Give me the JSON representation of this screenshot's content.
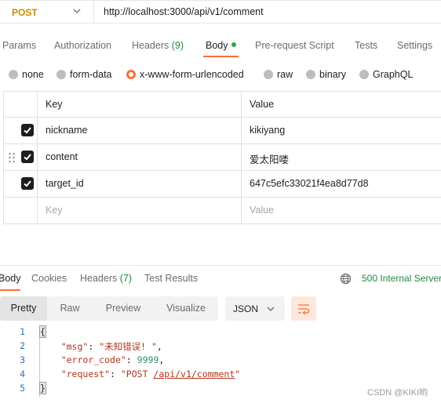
{
  "request": {
    "method": "POST",
    "url": "http://localhost:3000/api/v1/comment"
  },
  "request_tabs": {
    "params": "Params",
    "authorization": "Authorization",
    "headers": "Headers",
    "headers_count": "(9)",
    "body": "Body",
    "pre_request": "Pre-request Script",
    "tests": "Tests",
    "settings": "Settings"
  },
  "body_types": {
    "none": "none",
    "form_data": "form-data",
    "urlencoded": "x-www-form-urlencoded",
    "raw": "raw",
    "binary": "binary",
    "graphql": "GraphQL",
    "selected": "x-www-form-urlencoded"
  },
  "params_table": {
    "headers": {
      "key": "Key",
      "value": "Value"
    },
    "rows": [
      {
        "key": "nickname",
        "value": "kikiyang",
        "checked": true
      },
      {
        "key": "content",
        "value": "爱太阳喽",
        "checked": true
      },
      {
        "key": "target_id",
        "value": "647c5efc33021f4ea8d77d8",
        "checked": true
      }
    ],
    "placeholder": {
      "key": "Key",
      "value": "Value"
    }
  },
  "response_tabs": {
    "body": "Body",
    "cookies": "Cookies",
    "headers": "Headers",
    "headers_count": "(7)",
    "test_results": "Test Results"
  },
  "status": "500 Internal Server",
  "viewer": {
    "modes": {
      "pretty": "Pretty",
      "raw": "Raw",
      "preview": "Preview",
      "visualize": "Visualize"
    },
    "format": "JSON"
  },
  "response_body": {
    "line_numbers": [
      "1",
      "2",
      "3",
      "4",
      "5"
    ],
    "open_brace": "{",
    "close_brace": "}",
    "msg_key": "\"msg\"",
    "msg_value": "\"未知错误! \"",
    "error_code_key": "\"error_code\"",
    "error_code_value": "9999",
    "request_key": "\"request\"",
    "request_prefix": "\"POST ",
    "request_path": "/api/v1/comment",
    "request_suffix": "\""
  },
  "watermark": "CSDN @KIKI哟",
  "colors": {
    "accent": "#ff6c37",
    "method": "#c98a00",
    "status_ok_text": "#1f8a3b"
  }
}
